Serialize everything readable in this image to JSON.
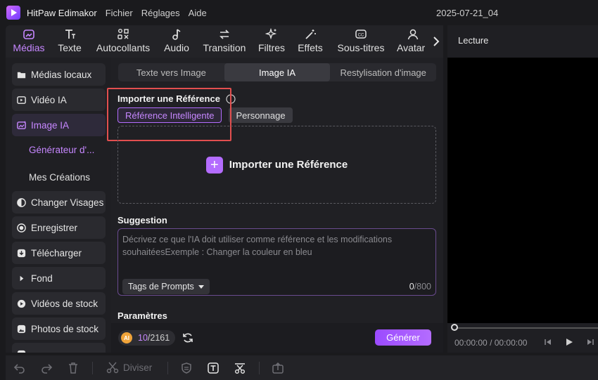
{
  "app": {
    "name": "HitPaw Edimakor",
    "menus": [
      "Fichier",
      "Réglages",
      "Aide"
    ],
    "project_title": "2025-07-21_04"
  },
  "toolbar": {
    "tabs": [
      {
        "label": "Médias",
        "icon": "media-icon"
      },
      {
        "label": "Texte",
        "icon": "text-icon"
      },
      {
        "label": "Autocollants",
        "icon": "stickers-icon"
      },
      {
        "label": "Audio",
        "icon": "music-note-icon"
      },
      {
        "label": "Transition",
        "icon": "transition-icon"
      },
      {
        "label": "Filtres",
        "icon": "sparkle-icon"
      },
      {
        "label": "Effets",
        "icon": "magic-wand-icon"
      },
      {
        "label": "Sous-titres",
        "icon": "subtitles-icon"
      },
      {
        "label": "Avatar",
        "icon": "avatar-icon"
      }
    ],
    "active": "Médias"
  },
  "sidebar": {
    "items": [
      {
        "label": "Médias locaux",
        "icon": "folder-icon"
      },
      {
        "label": "Vidéo IA",
        "icon": "ai-video-icon"
      },
      {
        "label": "Image IA",
        "icon": "ai-image-icon"
      },
      {
        "label": "Générateur d'...",
        "sub": true
      },
      {
        "label": "Mes Créations",
        "sub": true
      },
      {
        "label": "Changer Visages",
        "icon": "face-swap-icon"
      },
      {
        "label": "Enregistrer",
        "icon": "record-icon"
      },
      {
        "label": "Télécharger",
        "icon": "download-icon"
      },
      {
        "label": "Fond",
        "icon": "caret-right-icon"
      },
      {
        "label": "Vidéos de stock",
        "icon": "stock-video-icon"
      },
      {
        "label": "Photos de stock",
        "icon": "stock-photo-icon"
      }
    ],
    "active": "Image IA",
    "active_sub": "Générateur d'..."
  },
  "panel": {
    "mode_tabs": [
      "Texte vers Image",
      "Image IA",
      "Restylisation d'image"
    ],
    "active_mode": "Image IA",
    "reference": {
      "title": "Importer une Référence",
      "tabs": [
        "Référence Intelligente",
        "Personnage"
      ],
      "active_tab": "Référence Intelligente",
      "drop_label": "Importer une Référence"
    },
    "suggestion": {
      "title": "Suggestion",
      "placeholder": "Décrivez ce que l'IA doit utiliser comme référence et les modifications souhaitéesExemple : Changer la couleur en bleu",
      "tags_label": "Tags de Prompts",
      "count_used": "0",
      "count_max": "/800"
    },
    "params_title": "Paramètres",
    "credits": {
      "coin": "AI",
      "used": "10",
      "total": "/2161"
    },
    "generate_label": "Générer"
  },
  "preview": {
    "title": "Lecture",
    "time_current": "00:00:00",
    "time_sep": "/",
    "time_total": "00:00:00"
  },
  "editbar": {
    "split_label": "Diviser"
  },
  "colors": {
    "accent": "#b46cff",
    "highlight": "#e24f4f",
    "bg": "#1a1a1d"
  }
}
